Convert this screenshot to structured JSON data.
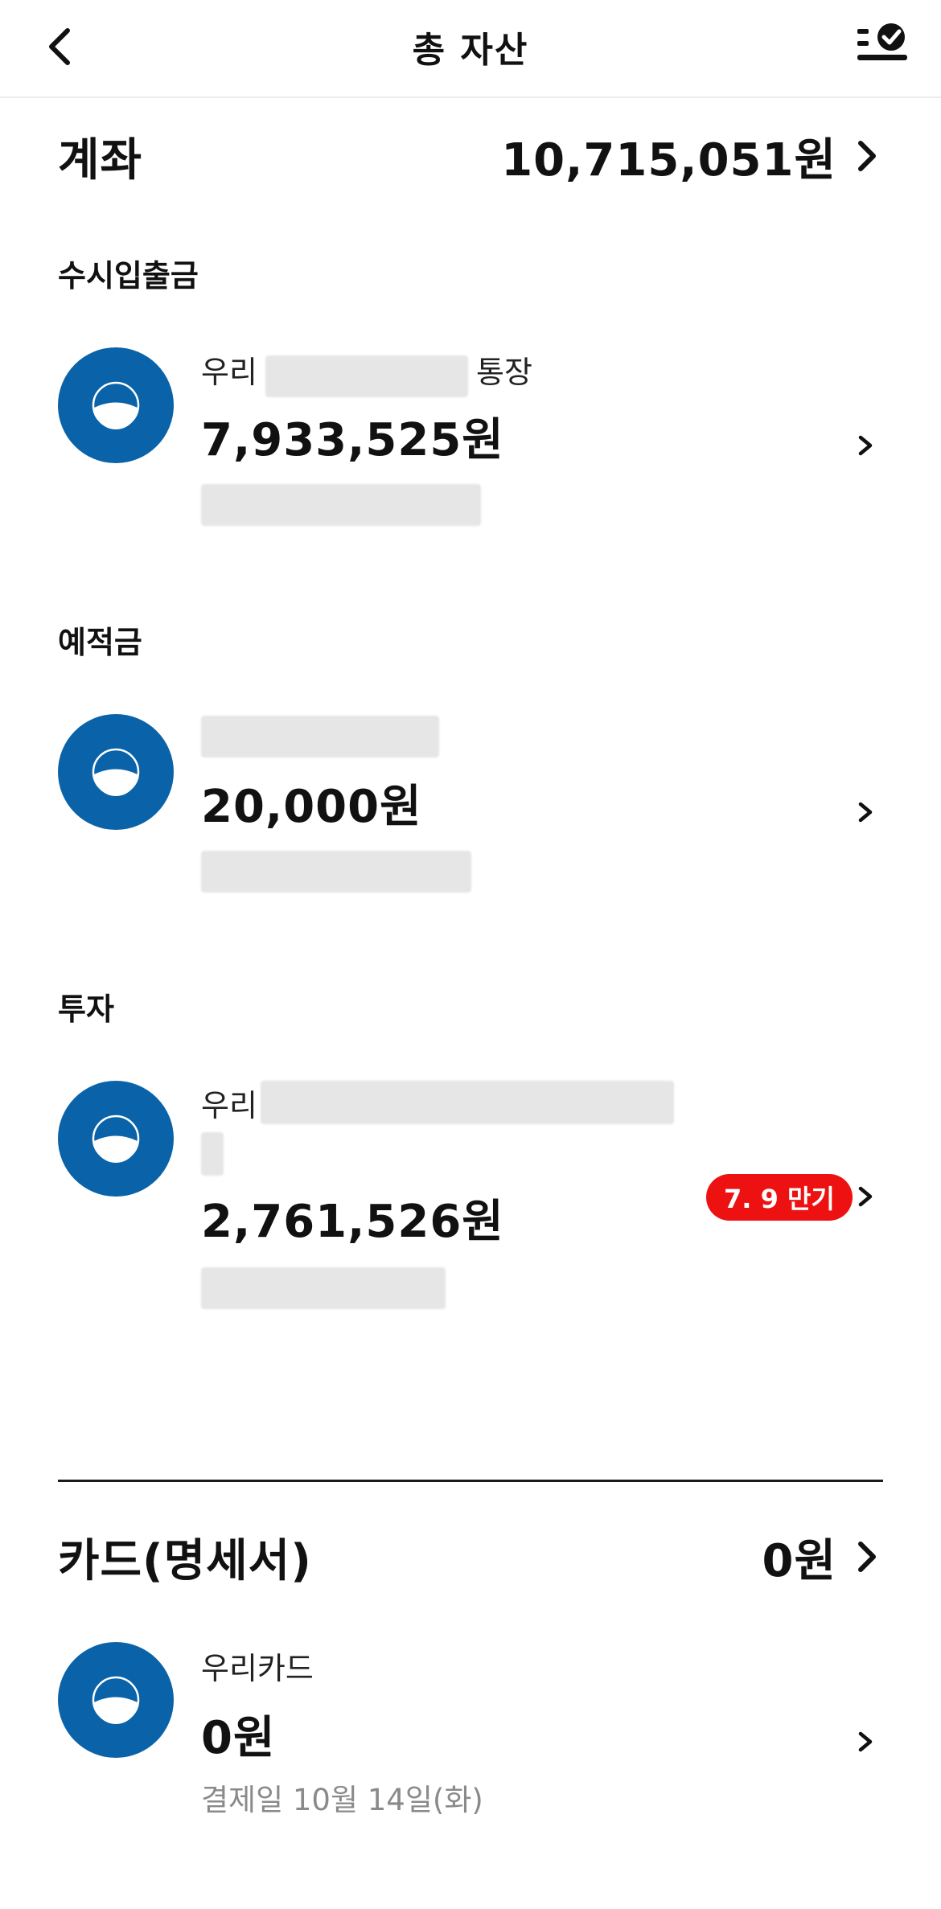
{
  "header": {
    "title": "총 자산",
    "back_icon": "chevron-left-icon",
    "settings_icon": "list-check-icon"
  },
  "accounts": {
    "title": "계좌",
    "total": "10,715,051원",
    "categories": [
      {
        "label": "수시입출금",
        "items": [
          {
            "name_prefix": "우리",
            "name_suffix": "통장",
            "amount": "7,933,525원"
          }
        ]
      },
      {
        "label": "예적금",
        "items": [
          {
            "name_prefix": "",
            "name_suffix": "",
            "amount": "20,000원"
          }
        ]
      },
      {
        "label": "투자",
        "items": [
          {
            "name_prefix": "우리",
            "name_suffix": "",
            "amount": "2,761,526원",
            "badge": "7. 9 만기"
          }
        ]
      }
    ]
  },
  "cards": {
    "title": "카드(명세서)",
    "total": "0원",
    "items": [
      {
        "name": "우리카드",
        "amount": "0원",
        "sub": "결제일 10월 14일(화)"
      }
    ]
  },
  "colors": {
    "brand_blue": "#0a63a8",
    "badge_red": "#ee1111",
    "muted_text": "#8a8a8a"
  }
}
